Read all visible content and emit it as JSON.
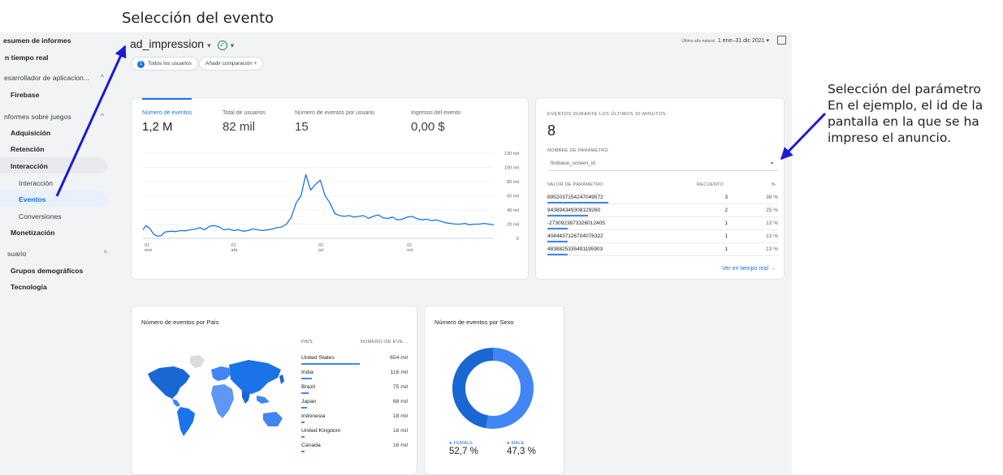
{
  "annotations": {
    "event_selection": "Selección del evento",
    "param_selection": [
      "Selección del parámetro",
      "En el ejemplo, el id de la",
      "pantalla en la que se ha",
      "impreso el anuncio."
    ]
  },
  "sidebar": {
    "items": [
      {
        "label": "esumen de informes",
        "style": "bold"
      },
      {
        "label": "n tiempo real",
        "style": "bold"
      },
      {
        "label": "esarrollador de aplicacion...",
        "style": "section",
        "chevron": "^"
      },
      {
        "label": "Firebase",
        "style": "bold"
      },
      {
        "label": "nformes sobre juegos",
        "style": "section",
        "chevron": "^"
      },
      {
        "label": "Adquisición",
        "style": "bold"
      },
      {
        "label": "Retención",
        "style": "bold"
      },
      {
        "label": "Interacción",
        "style": "bold",
        "selected_group": true
      },
      {
        "label": "Interacción",
        "style": "sub"
      },
      {
        "label": "Eventos",
        "style": "sub",
        "active": true
      },
      {
        "label": "Conversiones",
        "style": "sub"
      },
      {
        "label": "Monetización",
        "style": "bold"
      },
      {
        "label": "suario",
        "style": "section",
        "chevron": "^"
      },
      {
        "label": "Grupos demográficos",
        "style": "bold"
      },
      {
        "label": "Tecnología",
        "style": "bold"
      }
    ]
  },
  "header": {
    "event_name": "ad_impression",
    "dropdown_arrow": "▾",
    "status_check": "✓",
    "comparison_chip_number": "1",
    "comparison_chip": "Todos los usuarios",
    "add_comparison": "Añadir comparación +",
    "date_range_label": "Último año natural",
    "date_range": "1 ene–31 dic 2021 ▾"
  },
  "metrics": [
    {
      "label": "Número de eventos",
      "value": "1,2 M",
      "active": true
    },
    {
      "label": "Total de usuarios",
      "value": "82 mil"
    },
    {
      "label": "Número de eventos por usuario",
      "value": "15"
    },
    {
      "label": "Ingresos del evento",
      "value": "0,00 $"
    }
  ],
  "chart_data": {
    "type": "line",
    "y_ticks": [
      "120 mil",
      "100 mil",
      "80 mil",
      "60 mil",
      "40 mil",
      "20 mil",
      "0"
    ],
    "x_ticks": [
      {
        "day": "01",
        "month": "ene"
      },
      {
        "day": "01",
        "month": "abr"
      },
      {
        "day": "01",
        "month": "jul"
      },
      {
        "day": "01",
        "month": "oct"
      }
    ],
    "ylim": [
      0,
      120000
    ],
    "x": [
      1,
      4,
      8,
      12,
      16,
      20,
      24,
      30,
      35,
      40,
      45,
      50,
      55,
      60,
      65,
      70,
      75,
      80,
      85,
      90,
      95,
      100,
      105,
      110,
      115,
      120,
      125,
      130,
      135,
      140,
      145,
      150,
      155,
      160,
      165,
      170,
      175,
      180,
      185,
      190,
      195,
      200,
      205,
      210,
      215,
      220,
      225,
      230,
      235,
      240,
      245,
      250,
      255,
      260,
      265,
      270,
      275,
      280,
      285,
      290,
      295,
      300,
      305,
      310,
      315,
      320,
      325,
      330,
      335,
      340,
      345,
      350,
      355,
      360,
      365
    ],
    "values": [
      12000,
      18000,
      14000,
      6000,
      3000,
      4000,
      9000,
      10000,
      9500,
      11000,
      10500,
      12000,
      13000,
      15000,
      12000,
      17000,
      18000,
      16000,
      12000,
      13000,
      11000,
      12000,
      10000,
      11000,
      13000,
      12000,
      11000,
      12000,
      13000,
      15000,
      16000,
      20000,
      30000,
      50000,
      60000,
      90000,
      68000,
      76000,
      82000,
      60000,
      50000,
      35000,
      32000,
      31000,
      32000,
      30000,
      31000,
      32000,
      28000,
      31000,
      33000,
      29000,
      28000,
      30000,
      26000,
      27000,
      30000,
      31000,
      28000,
      26000,
      27000,
      25000,
      26000,
      24000,
      22000,
      21000,
      20000,
      20000,
      21000,
      19000,
      20000,
      20000,
      21000,
      20000,
      19000
    ]
  },
  "realtime": {
    "title": "EVENTOS DURANTE LOS ÚLTIMOS 30 MINUTOS",
    "count": "8",
    "param_label": "NOMBRE DE PARÁMETRO",
    "param_value": "firebase_screen_id",
    "param_caret": "▾",
    "head_value": "VALOR DE PARÁMETRO",
    "head_count": "RECUENTO",
    "head_pct": "%",
    "rows": [
      {
        "key": "8952037154247049572",
        "count": "3",
        "pct": "38 %",
        "share": 0.375
      },
      {
        "key": "943894349308129260",
        "count": "2",
        "pct": "25 %",
        "share": 0.25
      },
      {
        "key": "-2730923873326012405",
        "count": "1",
        "pct": "13 %",
        "share": 0.125
      },
      {
        "key": "4044437126704076322",
        "count": "1",
        "pct": "13 %",
        "share": 0.125
      },
      {
        "key": "4838825335491195903",
        "count": "1",
        "pct": "13 %",
        "share": 0.125
      }
    ],
    "link": "Ver en tiempo real →"
  },
  "country": {
    "title": "Número de eventos por País",
    "head_country": "PAÍS",
    "head_count": "NÚMERO DE EVE...",
    "rows": [
      {
        "country": "United States",
        "value": "654 mil",
        "share": 1.0
      },
      {
        "country": "India",
        "value": "116 mil",
        "share": 0.18
      },
      {
        "country": "Brazil",
        "value": "75 mil",
        "share": 0.12
      },
      {
        "country": "Japan",
        "value": "68 mil",
        "share": 0.1
      },
      {
        "country": "Indonesia",
        "value": "18 mil",
        "share": 0.03
      },
      {
        "country": "United Kingdom",
        "value": "16 mil",
        "share": 0.025
      },
      {
        "country": "Canada",
        "value": "16 mil",
        "share": 0.025
      }
    ]
  },
  "gender": {
    "title": "Número de eventos por Sexo",
    "slices": [
      {
        "label": "FEMALE",
        "value": "52,7 %",
        "share": 0.527,
        "color": "#4285f4"
      },
      {
        "label": "MALE",
        "value": "47,3 %",
        "share": 0.473,
        "color": "#1967d2"
      }
    ]
  },
  "colors": {
    "accent": "#1a73e8",
    "line": "#1a73e8",
    "arrow": "#1a1ad6",
    "nav_pill": "#e8f0fe",
    "group_pill": "#e8eaed"
  }
}
